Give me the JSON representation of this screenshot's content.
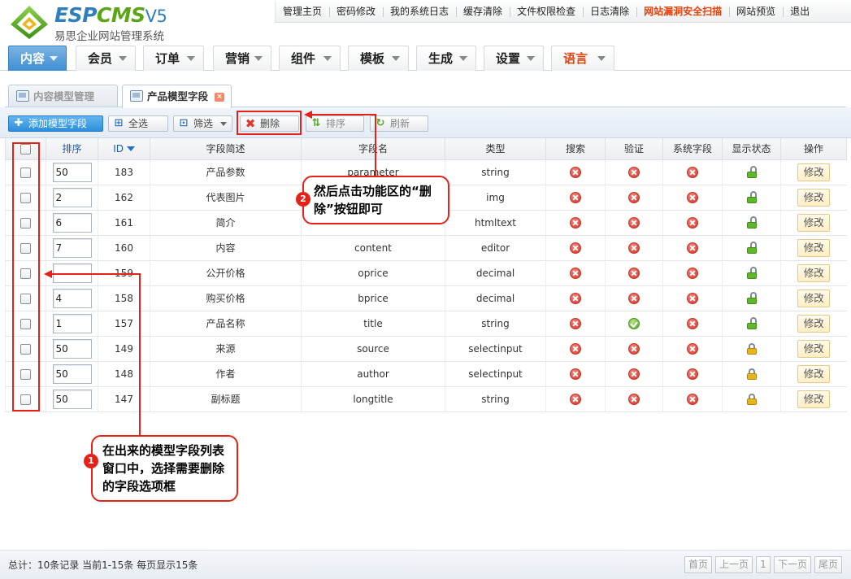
{
  "logo": {
    "text_blue": "ESP",
    "text_green": "CMS",
    "version": "V5",
    "subtitle": "易思企业网站管理系统"
  },
  "top_links": [
    {
      "label": "管理主页"
    },
    {
      "label": "密码修改"
    },
    {
      "label": "我的系统日志"
    },
    {
      "label": "缓存清除"
    },
    {
      "label": "文件权限检查"
    },
    {
      "label": "日志清除"
    },
    {
      "label": "网站漏洞安全扫描",
      "highlight": true
    },
    {
      "label": "网站预览"
    },
    {
      "label": "退出"
    }
  ],
  "nav": [
    {
      "label": "内容",
      "active": true
    },
    {
      "label": "会员"
    },
    {
      "label": "订单"
    },
    {
      "label": "营销"
    },
    {
      "label": "组件"
    },
    {
      "label": "模板"
    },
    {
      "label": "生成"
    },
    {
      "label": "设置"
    },
    {
      "label": "语言",
      "highlight": true
    }
  ],
  "tabs": [
    {
      "label": "内容模型管理",
      "active": false
    },
    {
      "label": "产品模型字段",
      "active": true,
      "close": "×"
    }
  ],
  "toolbar": {
    "add": {
      "label": "添加模型字段",
      "icon": "✚"
    },
    "select_all": {
      "label": "全选",
      "icon": "⊞"
    },
    "filter": {
      "label": "筛选",
      "icon": "⊡"
    },
    "delete": {
      "label": "删除",
      "icon": "✖"
    },
    "sort": {
      "label": "排序",
      "icon": "⇅"
    },
    "refresh": {
      "label": "刷新",
      "icon": "↻"
    }
  },
  "table": {
    "headers": {
      "sort": "排序",
      "id": "ID",
      "desc": "字段简述",
      "name": "字段名",
      "type": "类型",
      "search": "搜索",
      "validate": "验证",
      "system": "系统字段",
      "display": "显示状态",
      "action": "操作"
    },
    "edit_label": "修改",
    "rows": [
      {
        "sort": "50",
        "id": "183",
        "desc": "产品参数",
        "name": "parameter",
        "type": "string",
        "search": false,
        "validate": false,
        "system": false,
        "display": "open"
      },
      {
        "sort": "2",
        "id": "162",
        "desc": "代表图片",
        "name": "",
        "type": "img",
        "search": false,
        "validate": false,
        "system": false,
        "display": "open"
      },
      {
        "sort": "6",
        "id": "161",
        "desc": "简介",
        "name": "",
        "type": "htmltext",
        "search": false,
        "validate": false,
        "system": false,
        "display": "open"
      },
      {
        "sort": "7",
        "id": "160",
        "desc": "内容",
        "name": "content",
        "type": "editor",
        "search": false,
        "validate": false,
        "system": false,
        "display": "open"
      },
      {
        "sort": "",
        "id": "159",
        "desc": "公开价格",
        "name": "oprice",
        "type": "decimal",
        "search": false,
        "validate": false,
        "system": false,
        "display": "open"
      },
      {
        "sort": "4",
        "id": "158",
        "desc": "购买价格",
        "name": "bprice",
        "type": "decimal",
        "search": false,
        "validate": false,
        "system": false,
        "display": "open"
      },
      {
        "sort": "1",
        "id": "157",
        "desc": "产品名称",
        "name": "title",
        "type": "string",
        "search": false,
        "validate": true,
        "system": false,
        "display": "open"
      },
      {
        "sort": "50",
        "id": "149",
        "desc": "来源",
        "name": "source",
        "type": "selectinput",
        "search": false,
        "validate": false,
        "system": false,
        "display": "closed"
      },
      {
        "sort": "50",
        "id": "148",
        "desc": "作者",
        "name": "author",
        "type": "selectinput",
        "search": false,
        "validate": false,
        "system": false,
        "display": "closed"
      },
      {
        "sort": "50",
        "id": "147",
        "desc": "副标题",
        "name": "longtitle",
        "type": "string",
        "search": false,
        "validate": false,
        "system": false,
        "display": "closed"
      }
    ]
  },
  "footer": {
    "info": "总计：10条记录 当前1-15条 每页显示15条",
    "first": "首页",
    "prev": "上一页",
    "page": "1",
    "next": "下一页",
    "last": "尾页"
  },
  "annotations": {
    "step1": {
      "number": "1",
      "text": "在出来的模型字段列表窗口中，选择需要删除的字段选项框"
    },
    "step2": {
      "number": "2",
      "text": "然后点击功能区的“删除”按钮即可"
    }
  },
  "colors": {
    "accent": "#3f8ed4",
    "warning": "#e2420c",
    "annotation": "#e62117"
  }
}
